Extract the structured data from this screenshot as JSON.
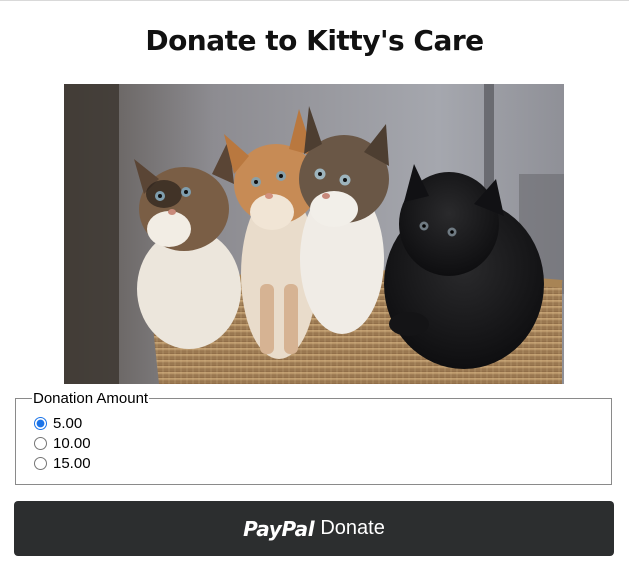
{
  "page": {
    "title": "Donate to Kitty's Care"
  },
  "photo": {
    "subject": "kittens-in-basket-photo"
  },
  "donation": {
    "legend": "Donation Amount",
    "options": [
      {
        "label": "5.00",
        "selected": true
      },
      {
        "label": "10.00",
        "selected": false
      },
      {
        "label": "15.00",
        "selected": false
      }
    ]
  },
  "paypal_button": {
    "brand": "PayPal",
    "label": "Donate"
  },
  "colors": {
    "button_bg": "#2c2e2f",
    "button_text": "#ffffff",
    "radio_accent": "#1a73e8",
    "title_text": "#111111"
  }
}
